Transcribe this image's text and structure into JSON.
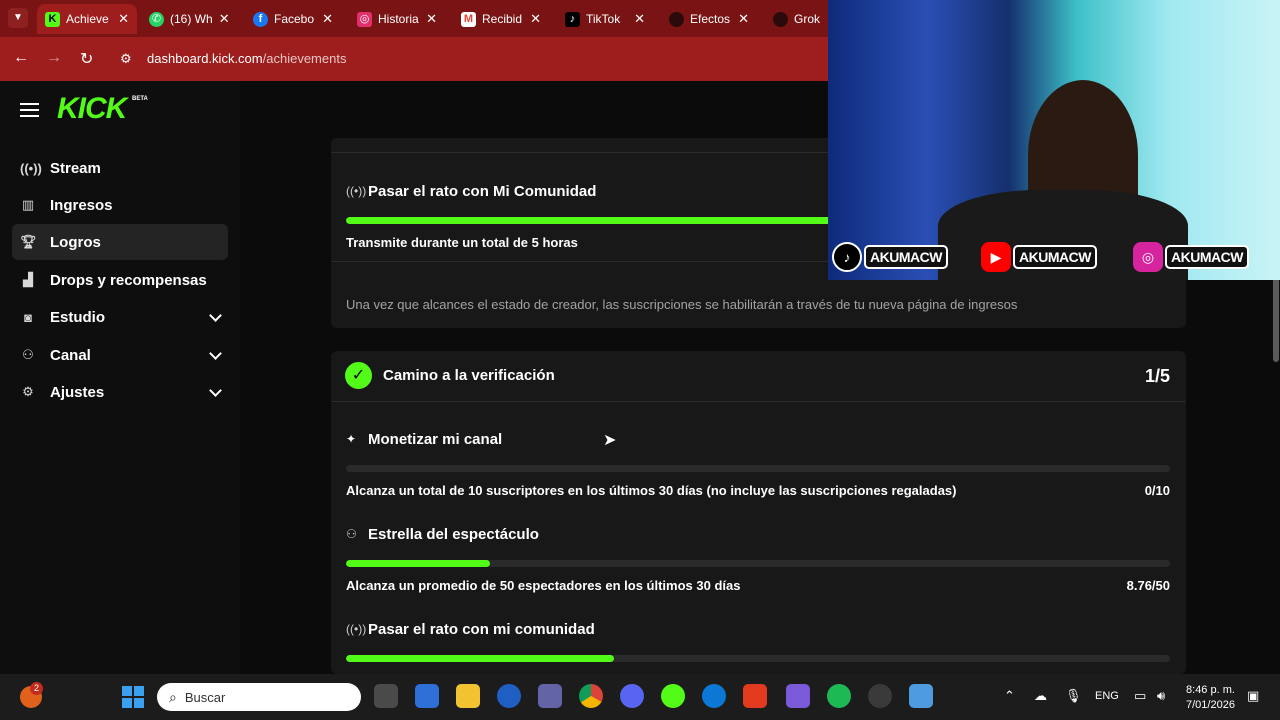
{
  "browser": {
    "tabs": [
      {
        "label": "Achieve",
        "favicon": "kick-favicon",
        "color": "#53fc18"
      },
      {
        "label": "(16) Wh",
        "favicon": "whatsapp-favicon",
        "color": "#25d366"
      },
      {
        "label": "Facebo",
        "favicon": "facebook-favicon",
        "color": "#1877f2"
      },
      {
        "label": "Historia",
        "favicon": "instagram-favicon",
        "color": "#e1306c"
      },
      {
        "label": "Recibid",
        "favicon": "gmail-favicon",
        "color": "#ea4335"
      },
      {
        "label": "TikTok",
        "favicon": "tiktok-favicon",
        "color": "#000000"
      },
      {
        "label": "Efectos",
        "favicon": "effects-favicon",
        "color": "#2a0a0a"
      },
      {
        "label": "Grok",
        "favicon": "grok-favicon",
        "color": "#2a0a0a"
      }
    ],
    "url_domain": "dashboard.kick.com",
    "url_path": "/achievements"
  },
  "app": {
    "logo": "KICK",
    "logo_badge": "BETA",
    "nav": [
      {
        "label": "Stream",
        "icon": "broadcast-icon",
        "expandable": false,
        "active": false
      },
      {
        "label": "Ingresos",
        "icon": "chart-icon",
        "expandable": false,
        "active": false
      },
      {
        "label": "Logros",
        "icon": "trophy-icon",
        "expandable": false,
        "active": true
      },
      {
        "label": "Drops y recompensas",
        "icon": "gift-icon",
        "expandable": false,
        "active": false
      },
      {
        "label": "Estudio",
        "icon": "studio-icon",
        "expandable": true,
        "active": false
      },
      {
        "label": "Canal",
        "icon": "channel-icon",
        "expandable": true,
        "active": false
      },
      {
        "label": "Ajustes",
        "icon": "gear-icon",
        "expandable": true,
        "active": false
      }
    ]
  },
  "affiliate_card": {
    "item_title": "Pasar el rato con Mi Comunidad",
    "item_desc": "Transmite durante un total de 5 horas",
    "item_progress": 1.0,
    "note": "Una vez que alcances el estado de creador, las suscripciones se habilitarán a través de tu nueva página de ingresos"
  },
  "verification_card": {
    "title": "Camino a la verificación",
    "count": "1/5",
    "items": [
      {
        "title": "Monetizar mi canal",
        "icon": "sparkle-icon",
        "desc": "Alcanza un total de 10 suscriptores en los últimos 30 días (no incluye las suscripciones regaladas)",
        "value": "0/10",
        "progress": 0.0
      },
      {
        "title": "Estrella del espectáculo",
        "icon": "viewers-icon",
        "desc": "Alcanza un promedio de 50 espectadores en los últimos 30 días",
        "value": "8.76/50",
        "progress": 0.175
      },
      {
        "title": "Pasar el rato con mi comunidad",
        "icon": "broadcast-icon",
        "desc": "",
        "value": "",
        "progress": 0.325
      }
    ]
  },
  "webcam": {
    "socials": [
      {
        "platform": "tiktok",
        "handle": "AKUMACW"
      },
      {
        "platform": "youtube",
        "handle": "AKUMACW"
      },
      {
        "platform": "instagram",
        "handle": "AKUMACW"
      }
    ]
  },
  "taskbar": {
    "search_placeholder": "Buscar",
    "notification_badge": "2",
    "language": "ENG",
    "time": "8:46 p. m.",
    "date": "7/01/2026"
  },
  "colors": {
    "accent": "#53fc18",
    "browser_chrome": "#9e1d1d"
  }
}
